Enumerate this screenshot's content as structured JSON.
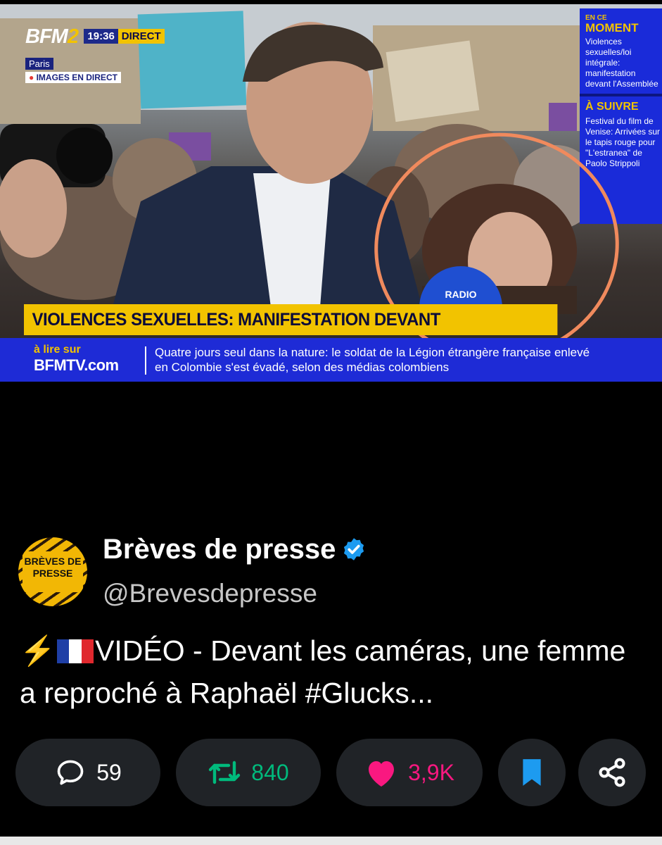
{
  "video": {
    "brand": "BFM",
    "brand_suffix": "2",
    "time": "19:36",
    "live": "DIRECT",
    "city": "Paris",
    "direct_label": "IMAGES EN DIRECT",
    "sidebar": {
      "now_small": "EN CE",
      "now_big": "MOMENT",
      "now_text": "Violences sexuelles/loi intégrale: manifestation devant l'Assemblée",
      "next_big": "À SUIVRE",
      "next_text": "Festival du film de Venise: Arrivées sur le tapis rouge pour \"L'estranea\" de Paolo Strippoli"
    },
    "banner": "VIOLENCES SEXUELLES: MANIFESTATION DEVANT L'ASSEMBLÉE",
    "ticker_source_small": "à lire sur",
    "ticker_source_big": "BFMTV.com",
    "ticker_text": "Quatre jours seul dans la nature: le soldat de la Légion étrangère française enlevé en Colombie s'est évadé, selon des médias colombiens",
    "mic_label": "RADIO",
    "annotation_color": "#f08a5d"
  },
  "tweet": {
    "avatar_text": "BRÈVES DE PRESSE",
    "name": "Brèves de presse",
    "handle": "@Brevesdepresse",
    "text_prefix": "⚡",
    "text": "VIDÉO - Devant les caméras, une femme a reproché à Raphaël #Glucks...",
    "actions": {
      "replies": "59",
      "retweets": "840",
      "likes": "3,9K"
    },
    "colors": {
      "retweet": "#00ba7c",
      "like": "#f91880",
      "bookmark": "#1d9bf0",
      "verified": "#1d9bf0"
    }
  }
}
